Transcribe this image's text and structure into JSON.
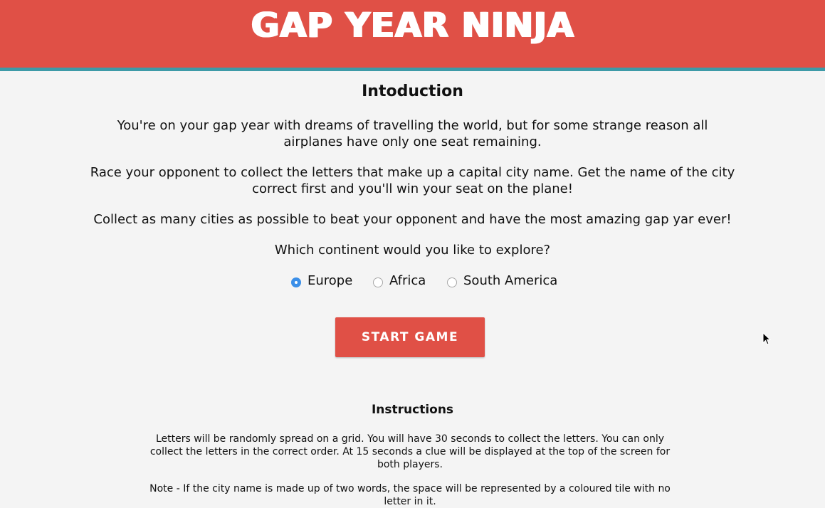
{
  "header": {
    "logo_text": "GAP YEAR NINJA",
    "color": "#e05046",
    "accent": "#3d9aa7"
  },
  "intro": {
    "title": "Intoduction",
    "p1_line1": "You're on your gap year with dreams of travelling the world, but for some strange reason all",
    "p1_line2": "airplanes have only one seat remaining.",
    "p2_line1": "Race your opponent to collect the letters that make up a capital city name. Get the name of the city",
    "p2_line2": "correct first and you'll win your seat on the plane!",
    "p3": "Collect as many cities as possible to beat your opponent and have the most amazing gap yar ever!",
    "question": "Which continent would you like to explore?"
  },
  "continents": {
    "selected": "Europe",
    "options": [
      {
        "label": "Europe",
        "checked": true
      },
      {
        "label": "Africa",
        "checked": false
      },
      {
        "label": "South America",
        "checked": false
      }
    ]
  },
  "start_button": {
    "label": "START GAME"
  },
  "instructions": {
    "title": "Instructions",
    "text": "Letters will be randomly spread on a grid. You will have 30 seconds to collect the letters. You can only collect the letters in the correct order. At 15 seconds a clue will be displayed at the top of the screen for both players.",
    "note": "Note - If the city name is made up of two words, the space will be represented by a coloured tile with no letter in it."
  },
  "icons": {
    "cursor": "mouse-pointer-icon"
  }
}
